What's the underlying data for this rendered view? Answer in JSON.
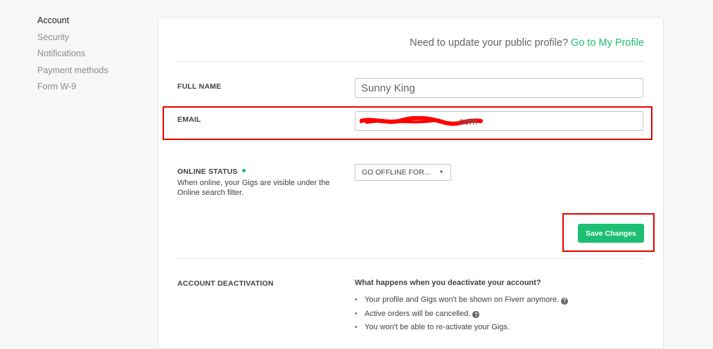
{
  "sidebar": {
    "items": [
      {
        "label": "Account",
        "active": true
      },
      {
        "label": "Security"
      },
      {
        "label": "Notifications"
      },
      {
        "label": "Payment methods"
      },
      {
        "label": "Form W-9"
      }
    ]
  },
  "profile_prompt": {
    "text": "Need to update your public profile?",
    "link": "Go to My Profile"
  },
  "full_name": {
    "label": "FULL NAME",
    "value": "Sunny King"
  },
  "email": {
    "label": "EMAIL",
    "visible_tail": "com"
  },
  "online_status": {
    "label": "ONLINE STATUS",
    "description": "When online, your Gigs are visible under the Online search filter.",
    "select_value": "GO OFFLINE FOR..."
  },
  "save_button": {
    "label": "Save Changes"
  },
  "deactivation": {
    "label": "ACCOUNT DEACTIVATION",
    "title": "What happens when you deactivate your account?",
    "items": [
      "Your profile and Gigs won't be shown on Fiverr anymore.",
      "Active orders will be cancelled.",
      "You won't be able to re-activate your Gigs."
    ]
  },
  "colors": {
    "accent": "#1dbf73",
    "highlight": "#e60000",
    "redaction": "#ff0000"
  },
  "icons": {
    "help": "question-circle-icon",
    "status": "green-dot-icon",
    "dropdown": "caret-down-icon"
  }
}
